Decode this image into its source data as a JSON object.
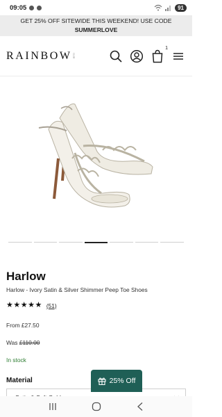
{
  "status_bar": {
    "time": "09:05",
    "battery": "91"
  },
  "promo": {
    "line": "GET 25% OFF SITEWIDE THIS WEEKEND! USE CODE",
    "code": "SUMMERLOVE"
  },
  "header": {
    "logo": "RAINBOW",
    "logo_tag": "CLUB",
    "cart_count": "1",
    "icons": [
      "search-icon",
      "account-icon",
      "cart-icon",
      "menu-icon"
    ]
  },
  "carousel": {
    "total": 7,
    "active_index": 3
  },
  "product": {
    "name": "Harlow",
    "subtitle": "Harlow - Ivory Satin & Silver Shimmer Peep Toe Shoes",
    "stars": "★★★★★",
    "reviews": "(51)",
    "price_from": "From £27.50",
    "was_label": "Was",
    "was_price": "£110.00",
    "stock": "In stock"
  },
  "material": {
    "label": "Material",
    "selected": "Satin & Soft Gold"
  },
  "discount_button": {
    "label": "25% Off"
  },
  "colors": {
    "accent": "#1f5f56",
    "stock": "#2e7d32",
    "banner": "#ececec"
  }
}
